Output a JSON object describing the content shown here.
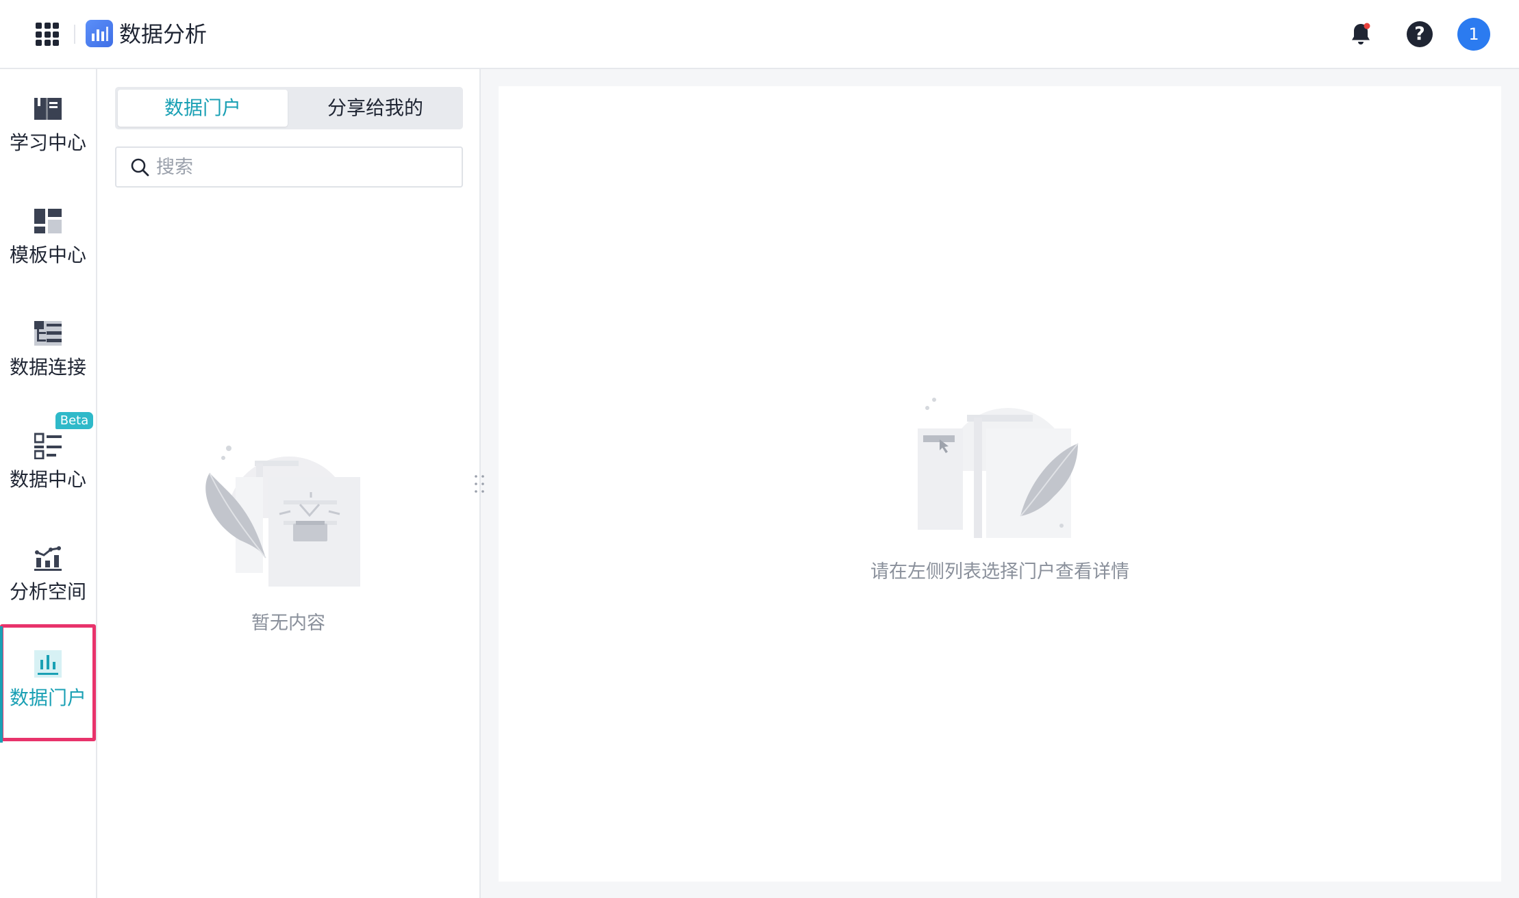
{
  "topbar": {
    "app_title": "数据分析",
    "avatar_text": "1"
  },
  "sidenav": {
    "items": [
      {
        "label": "学习中心",
        "icon": "book-icon"
      },
      {
        "label": "模板中心",
        "icon": "template-icon"
      },
      {
        "label": "数据连接",
        "icon": "data-connection-icon"
      },
      {
        "label": "数据中心",
        "icon": "data-center-icon",
        "badge": "Beta"
      },
      {
        "label": "分析空间",
        "icon": "analysis-space-icon"
      },
      {
        "label": "数据门户",
        "icon": "data-portal-icon",
        "active": true
      }
    ]
  },
  "list_panel": {
    "tabs": [
      {
        "label": "数据门户",
        "active": true
      },
      {
        "label": "分享给我的",
        "active": false
      }
    ],
    "search": {
      "placeholder": "搜索",
      "value": ""
    },
    "empty_text": "暂无内容"
  },
  "detail": {
    "empty_text": "请在左侧列表选择门户查看详情"
  },
  "colors": {
    "accent": "#1aa0b4",
    "badge": "#2fb9c9",
    "highlight_border": "#e8336b",
    "avatar": "#2b7bf0",
    "notification_dot": "#e8413c"
  }
}
